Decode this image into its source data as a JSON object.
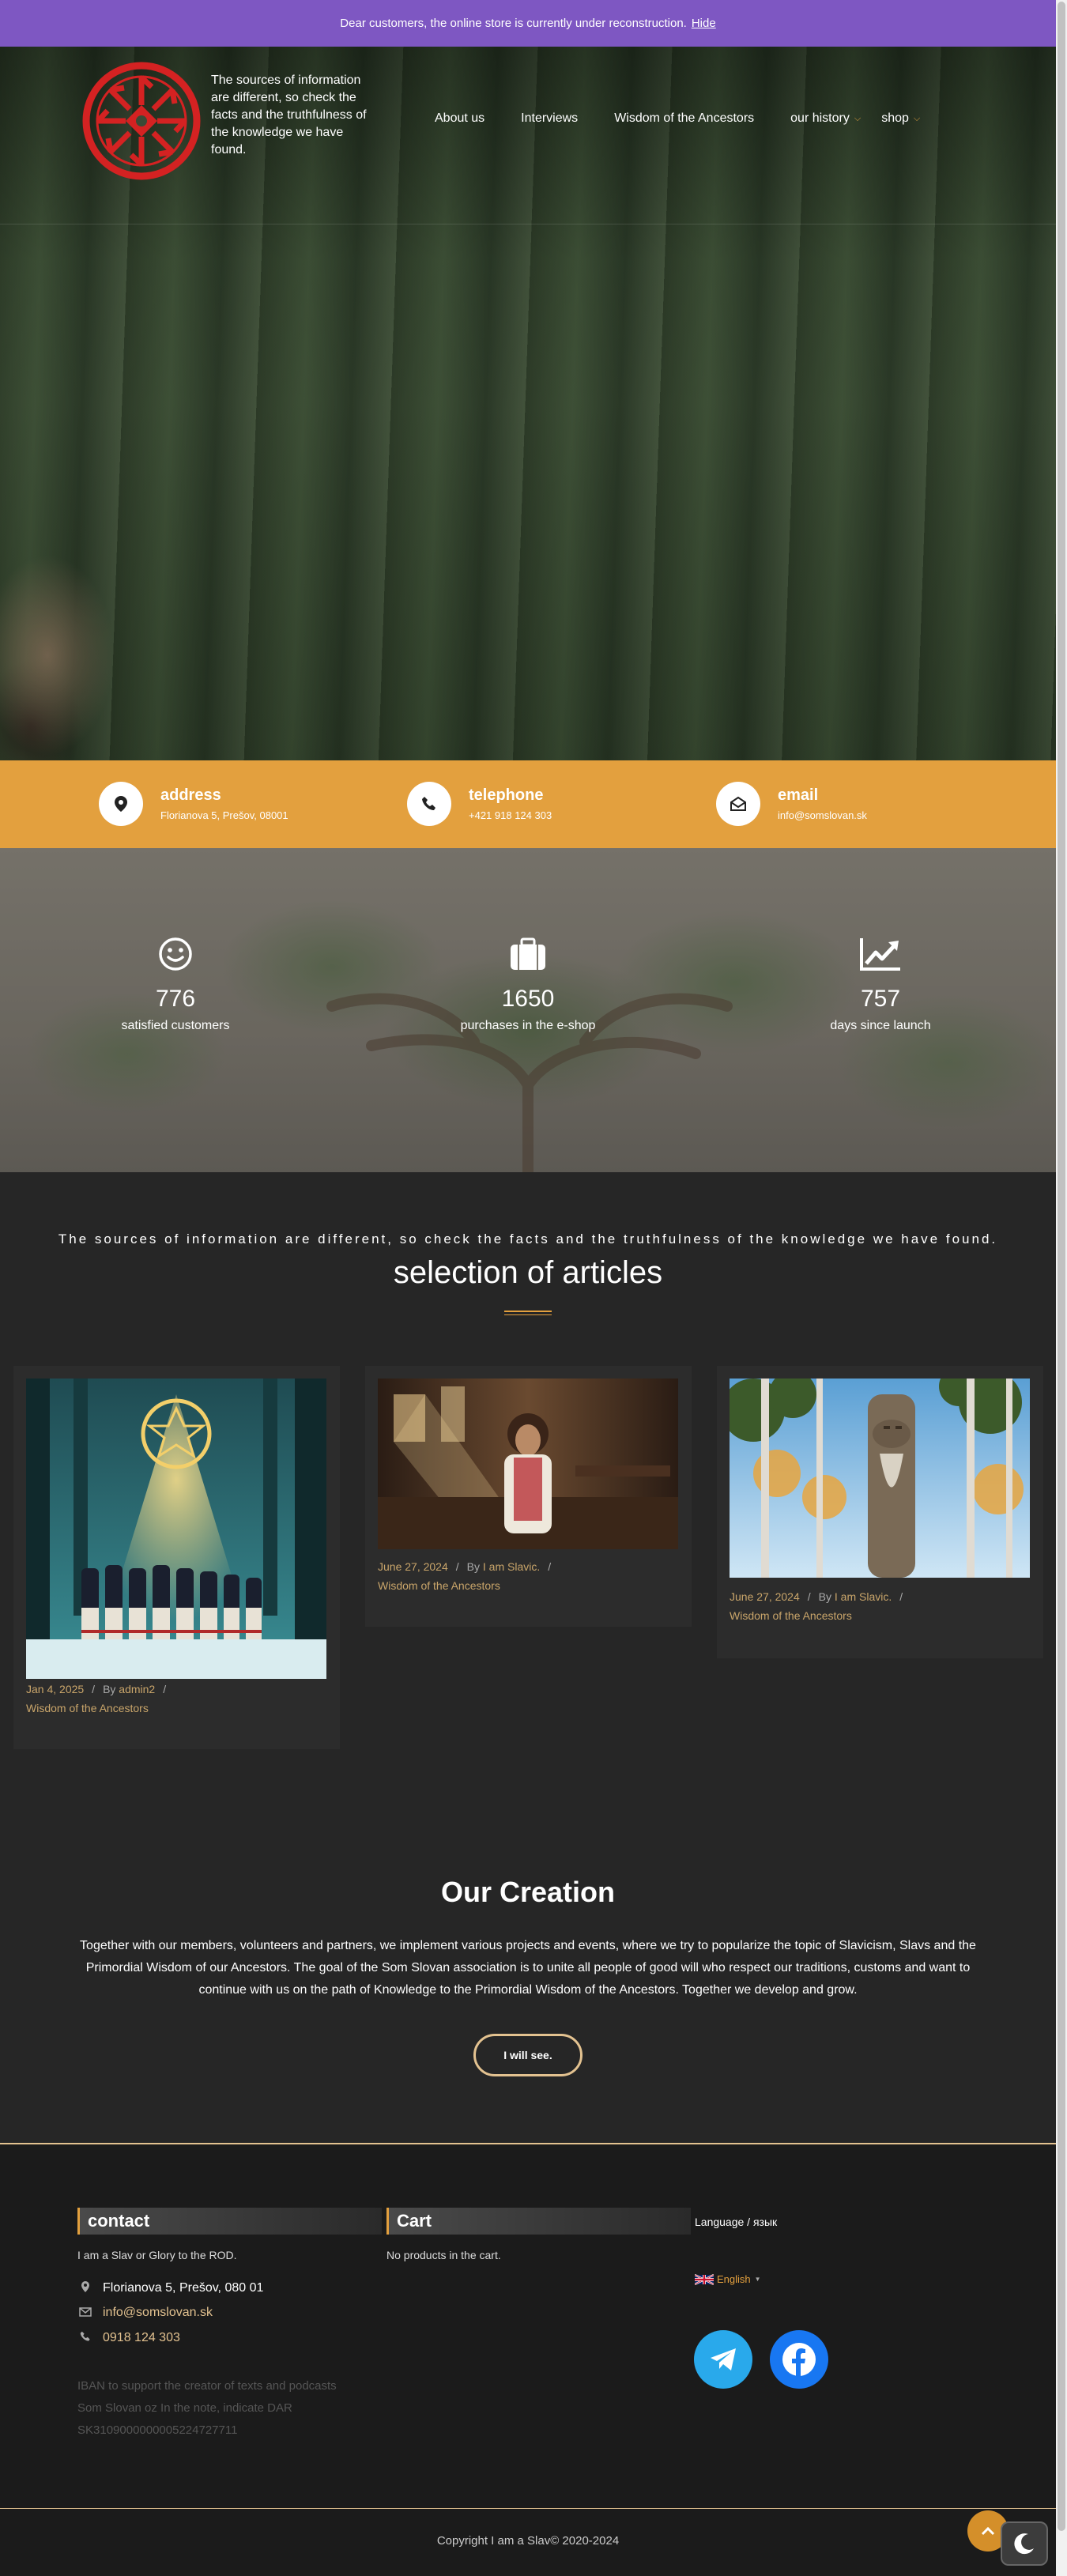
{
  "notice": {
    "text": "Dear customers, the online store is currently under reconstruction.",
    "hide_label": "Hide"
  },
  "header": {
    "tagline": "The sources of information are different, so check the facts and the truthfulness of the knowledge we have found.",
    "nav": [
      "About us",
      "Interviews",
      "Wisdom of the Ancestors",
      "our history",
      "shop"
    ]
  },
  "contact_bar": [
    {
      "icon": "map-marker-icon",
      "label": "address",
      "value": "Florianova 5, Prešov, 08001"
    },
    {
      "icon": "phone-icon",
      "label": "telephone",
      "value": "+421 918 124 303"
    },
    {
      "icon": "envelope-open-icon",
      "label": "email",
      "value": "info@somslovan.sk"
    }
  ],
  "stats": [
    {
      "icon": "smiley-icon",
      "value": "776",
      "label": "satisfied customers"
    },
    {
      "icon": "briefcase-icon",
      "value": "1650",
      "label": "purchases in the e-shop"
    },
    {
      "icon": "chart-line-icon",
      "value": "757",
      "label": "days since launch"
    }
  ],
  "articles": {
    "subtitle": "The sources of information are different, so check the facts and the truthfulness of the knowledge we have found.",
    "title": "selection of articles",
    "cards": [
      {
        "date": "Jan 4, 2025",
        "by": "By",
        "author": "admin2",
        "sep": "/",
        "category": "Wisdom of the Ancestors"
      },
      {
        "date": "June 27, 2024",
        "by": "By",
        "author": "I am Slavic.",
        "sep": "/",
        "category": "Wisdom of the Ancestors"
      },
      {
        "date": "June 27, 2024",
        "by": "By",
        "author": "I am Slavic.",
        "sep": "/",
        "category": "Wisdom of the Ancestors"
      }
    ]
  },
  "creation": {
    "title": "Our Creation",
    "text": "Together with our members, volunteers and partners, we implement various projects and events, where we try to popularize the topic of Slavicism, Slavs and the Primordial Wisdom of our Ancestors. The goal of the Som Slovan association is to unite all people of good will who respect our traditions, customs and want to continue with us on the path of Knowledge to the Primordial Wisdom of the Ancestors. Together we develop and grow.",
    "button": "I will see."
  },
  "footer": {
    "contact_title": "contact",
    "contact_intro": "I am a Slav or Glory to the ROD.",
    "address": "Florianova 5, Prešov, 080 01",
    "email": "info@somslovan.sk",
    "phone": "0918 124 303",
    "iban": "IBAN to support the creator of texts and podcasts Som Slovan oz In the note, indicate DAR SK3109000000005224727711",
    "cart_title": "Cart",
    "cart_empty": "No products in the cart.",
    "language_label": "Language / язык",
    "language_value": "English",
    "copyright": "Copyright I am a Slav© 2020-2024"
  },
  "colors": {
    "accent": "#e3a03e",
    "notice_bg": "#7e57c2",
    "dark_bg": "#262626",
    "footer_bg": "#1b1b1b",
    "link": "#c9a56a"
  }
}
